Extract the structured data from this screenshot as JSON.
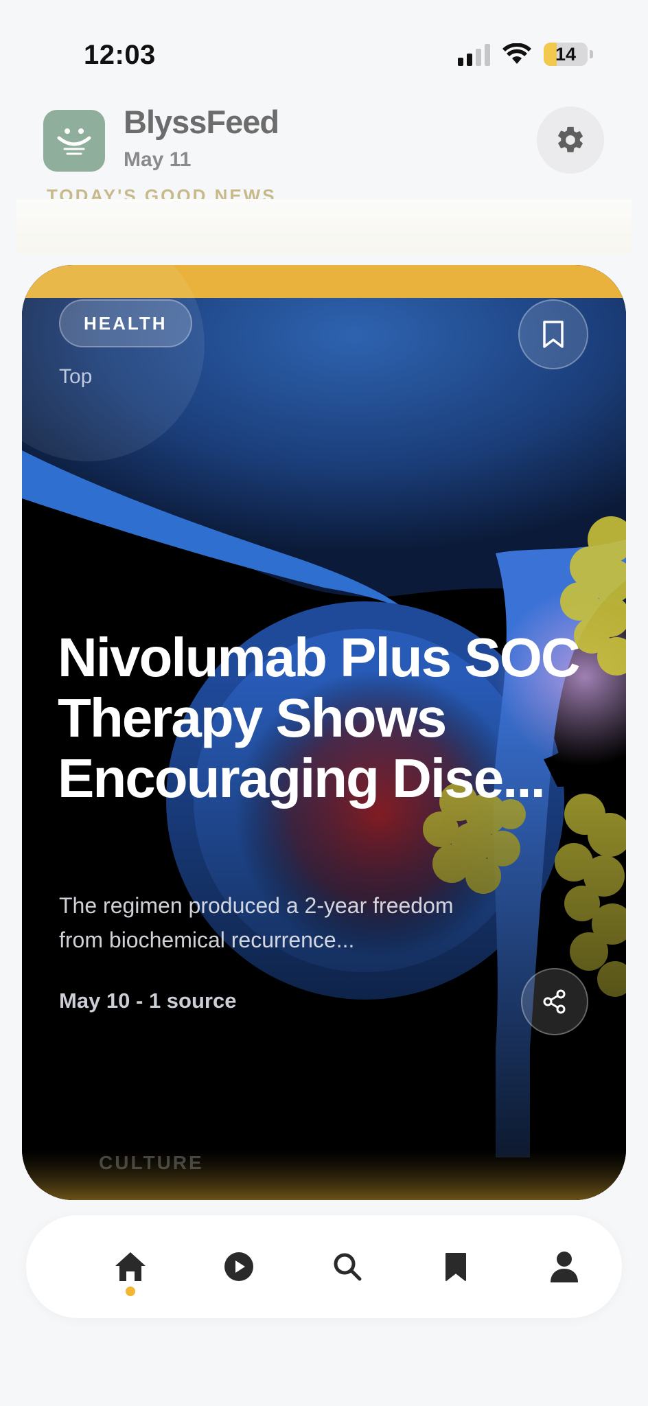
{
  "status_bar": {
    "time": "12:03",
    "battery_level": "14",
    "signal_bars_filled": 2,
    "signal_bars_total": 4,
    "icons": [
      "signal-icon",
      "wifi-icon",
      "battery-icon"
    ]
  },
  "header": {
    "app_name": "BlyssFeed",
    "date": "May 11",
    "tagline": "TODAY'S GOOD NEWS",
    "logo_icon": "smiling-face-icon",
    "settings_icon": "gear-icon"
  },
  "card": {
    "category": "HEALTH",
    "rank_label": "Top",
    "headline": "Nivolumab Plus SOC Therapy Shows Encouraging Dise...",
    "summary": "The regimen produced a 2-year freedom from biochemical recurrence...",
    "meta": "May 10 - 1 source",
    "bookmark_icon": "bookmark-outline-icon",
    "share_icon": "share-icon",
    "next_card_category": "CULTURE"
  },
  "bottom_nav": {
    "active_index": 0,
    "items": [
      {
        "name": "home",
        "icon": "home-icon"
      },
      {
        "name": "watch",
        "icon": "play-icon"
      },
      {
        "name": "search",
        "icon": "search-icon"
      },
      {
        "name": "saved",
        "icon": "bookmark-icon"
      },
      {
        "name": "profile",
        "icon": "person-icon"
      }
    ]
  },
  "colors": {
    "background": "#f6f7f9",
    "logo_bg": "#8fae9b",
    "tagline": "#c7b98a",
    "card_top_band": "#e8b23c",
    "active_indicator": "#f2b632",
    "nav_icon": "#2a2a2a"
  }
}
